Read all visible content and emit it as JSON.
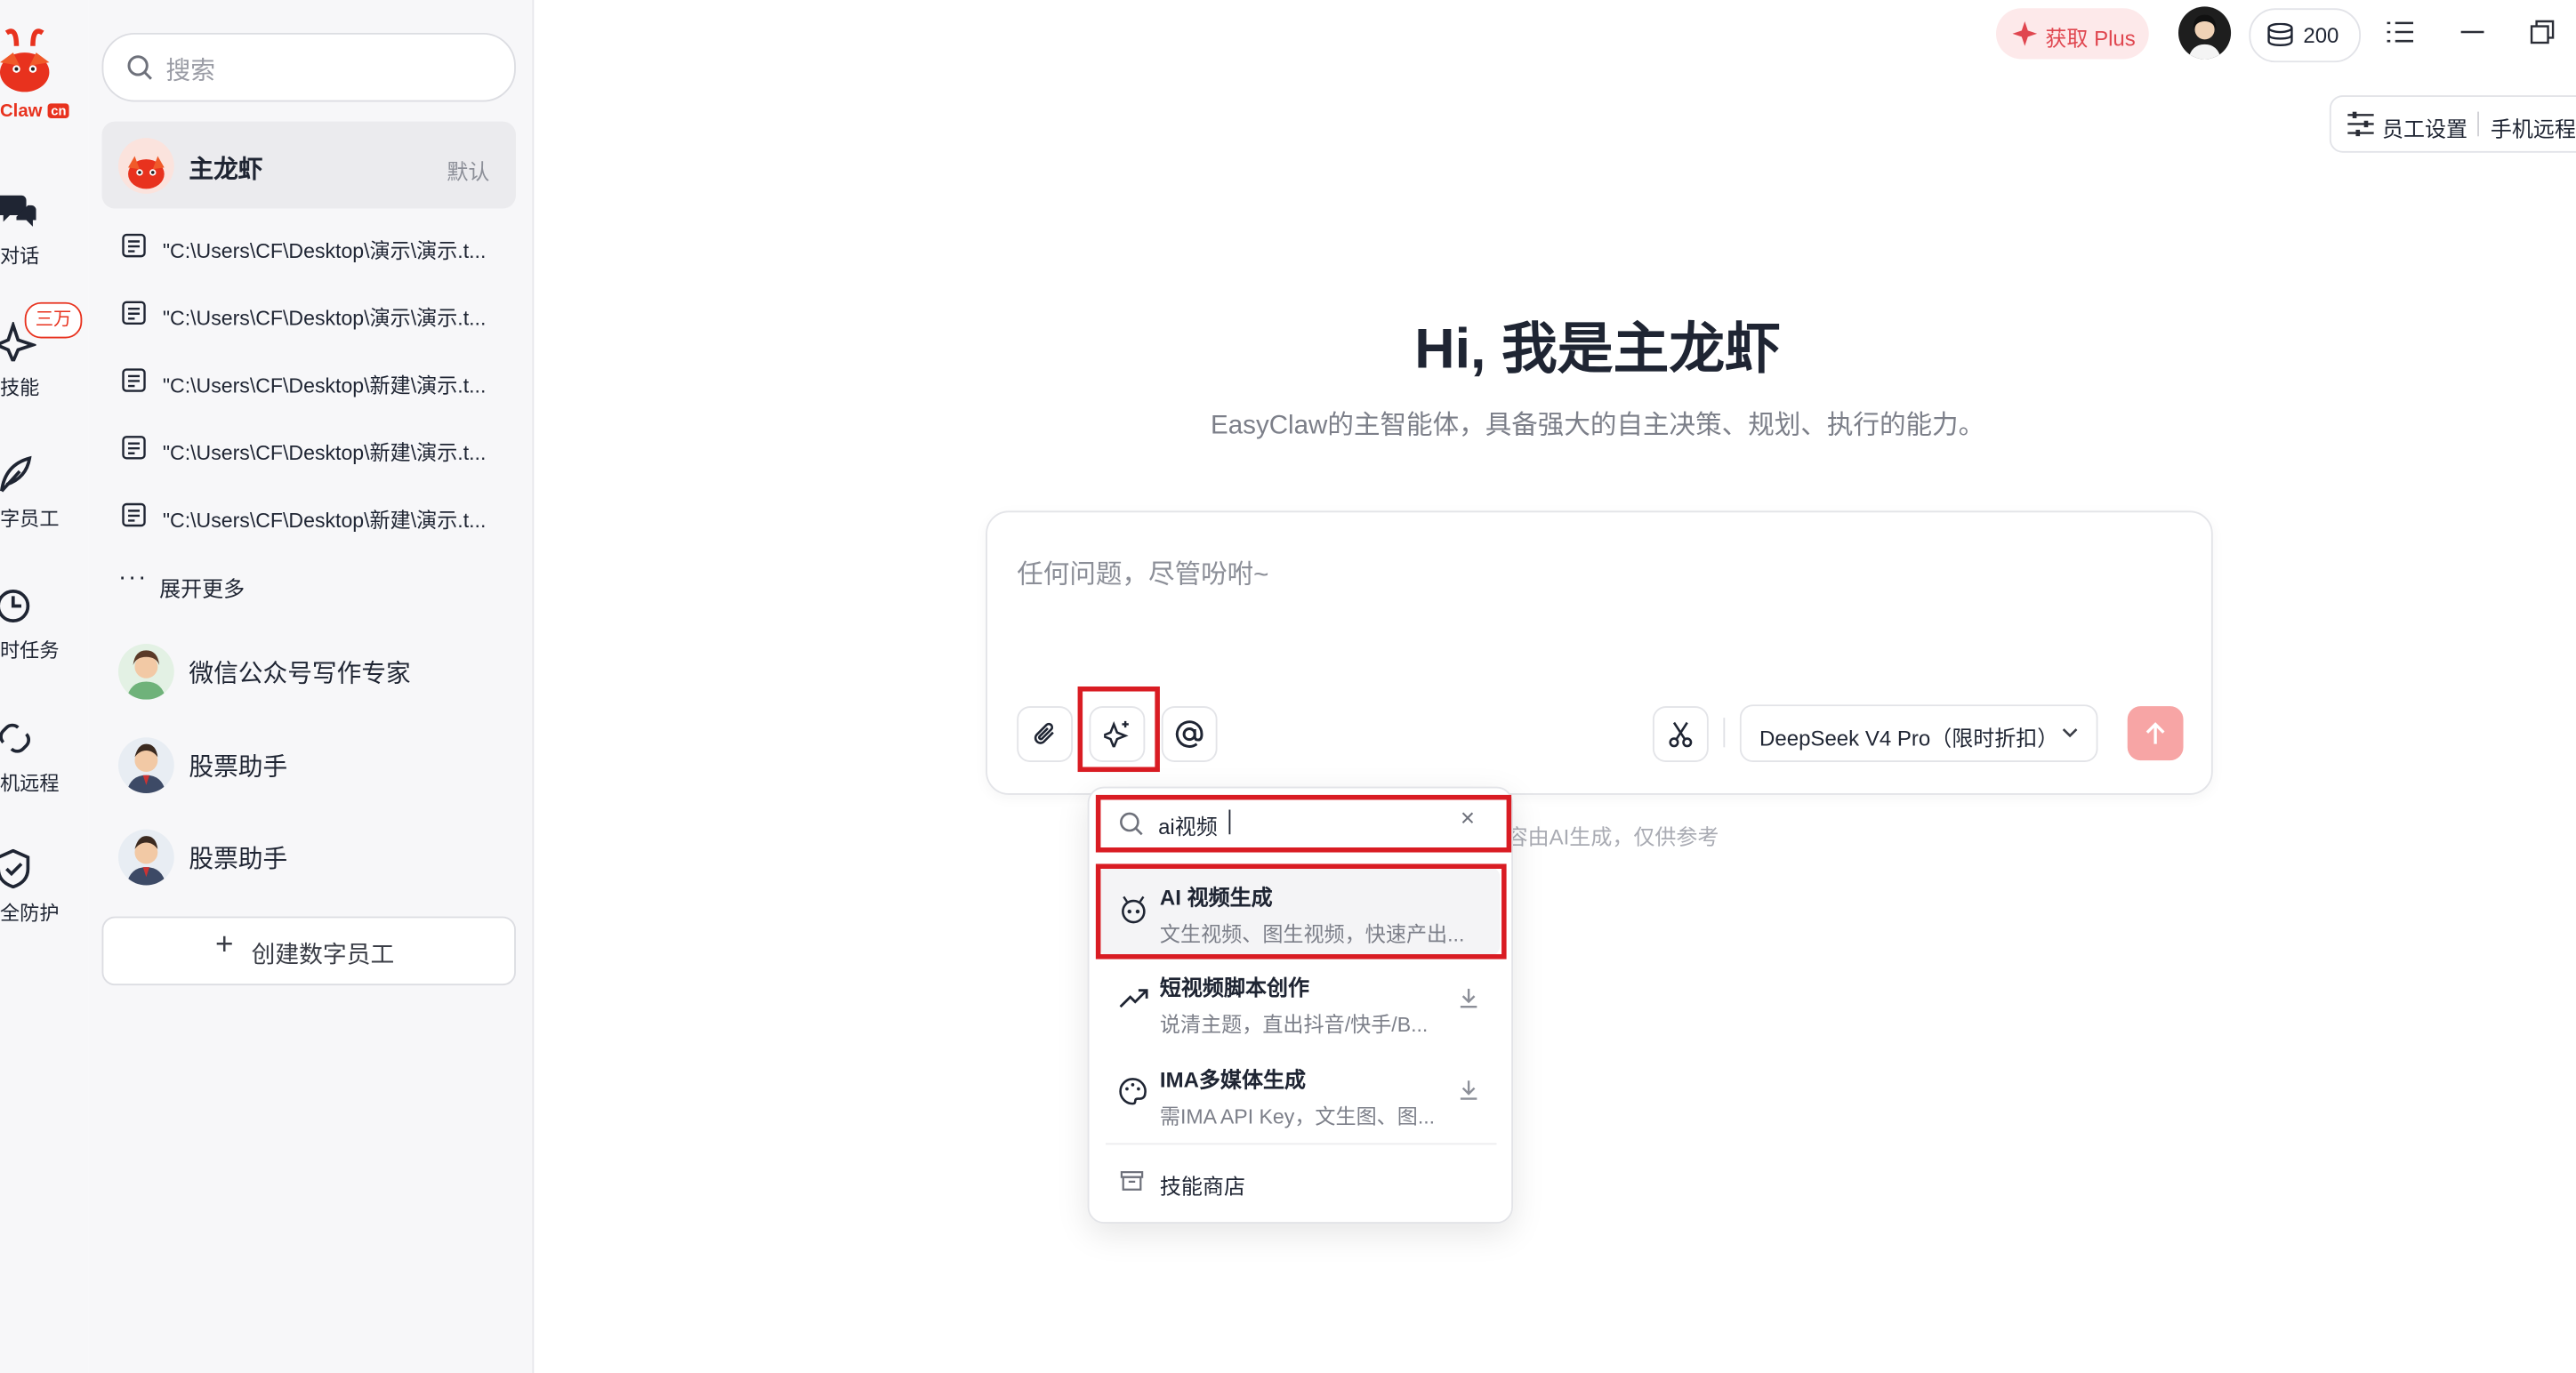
{
  "brand": {
    "logo_text": "Claw",
    "logo_badge": "cn"
  },
  "rail": {
    "items": [
      {
        "label": "对话",
        "icon": "chat-icon"
      },
      {
        "label": "技能",
        "icon": "sparkle-icon",
        "badge": "三万"
      },
      {
        "label": "字员工",
        "icon": "leaf-icon"
      },
      {
        "label": "时任务",
        "icon": "clock-icon"
      },
      {
        "label": "机远程",
        "icon": "link-icon"
      },
      {
        "label": "全防护",
        "icon": "shield-check-icon"
      }
    ]
  },
  "sessions": {
    "search_placeholder": "搜索",
    "main_agent": {
      "name": "主龙虾",
      "tag": "默认"
    },
    "history": [
      "\"C:\\Users\\CF\\Desktop\\演示\\演示.t...",
      "\"C:\\Users\\CF\\Desktop\\演示\\演示.t...",
      "\"C:\\Users\\CF\\Desktop\\新建\\演示.t...",
      "\"C:\\Users\\CF\\Desktop\\新建\\演示.t...",
      "\"C:\\Users\\CF\\Desktop\\新建\\演示.t..."
    ],
    "expand_more": "展开更多",
    "agents": [
      {
        "name": "微信公众号写作专家"
      },
      {
        "name": "股票助手"
      },
      {
        "name": "股票助手"
      }
    ],
    "create_label": "创建数字员工"
  },
  "topbar": {
    "plus_label": "获取 Plus",
    "credits": "200",
    "staff_settings": "员工设置",
    "phone_remote": "手机远程"
  },
  "hero": {
    "title": "Hi, 我是主龙虾",
    "subtitle": "EasyClaw的主智能体，具备强大的自主决策、规划、执行的能力。"
  },
  "composer": {
    "placeholder": "任何问题，尽管吩咐~",
    "model": "DeepSeek V4 Pro（限时折扣）",
    "disclaimer": "容由AI生成，仅供参考"
  },
  "skill_popup": {
    "search_value": "ai视频",
    "items": [
      {
        "title": "AI 视频生成",
        "desc": "文生视频、图生视频，快速产出...",
        "icon": "robot-icon",
        "installed": true
      },
      {
        "title": "短视频脚本创作",
        "desc": "说清主题，直出抖音/快手/B...",
        "icon": "trend-icon",
        "installed": false
      },
      {
        "title": "IMA多媒体生成",
        "desc": "需IMA API Key，文生图、图...",
        "icon": "palette-icon",
        "installed": false
      }
    ],
    "store_label": "技能商店"
  },
  "colors": {
    "accent": "#d91c23",
    "send": "#f7a5a5",
    "plus_bg": "#fde9ea",
    "plus_text": "#e0464f"
  }
}
